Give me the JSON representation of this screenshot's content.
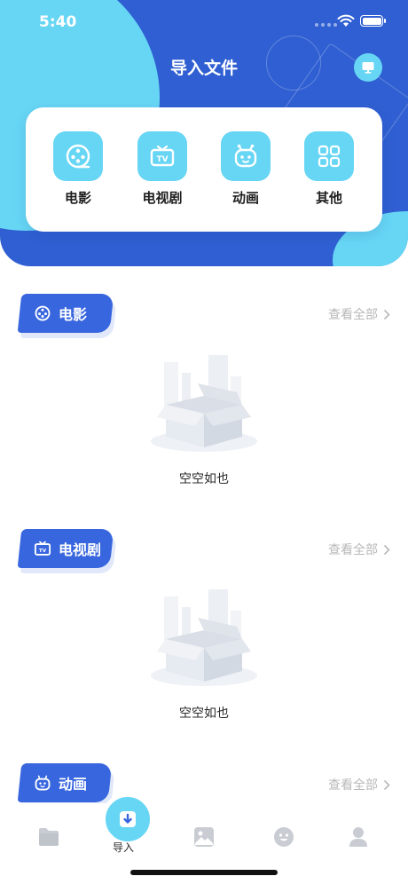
{
  "status_bar": {
    "time": "5:40"
  },
  "header": {
    "title": "导入文件"
  },
  "categories": [
    {
      "label": "电影",
      "icon": "film-reel-icon"
    },
    {
      "label": "电视剧",
      "icon": "tv-icon"
    },
    {
      "label": "动画",
      "icon": "robot-face-icon"
    },
    {
      "label": "其他",
      "icon": "grid-icon"
    }
  ],
  "sections": [
    {
      "title": "电影",
      "see_all": "查看全部",
      "empty_text": "空空如也"
    },
    {
      "title": "电视剧",
      "see_all": "查看全部",
      "empty_text": "空空如也"
    },
    {
      "title": "动画",
      "see_all": "查看全部"
    }
  ],
  "tabbar": {
    "center_label": "导入",
    "tabs": [
      "folder-icon",
      "import-icon",
      "image-icon",
      "smiley-icon",
      "profile-icon"
    ]
  },
  "colors": {
    "primary": "#2f5fd2",
    "accent": "#67d6f4",
    "tag": "#3866de"
  }
}
